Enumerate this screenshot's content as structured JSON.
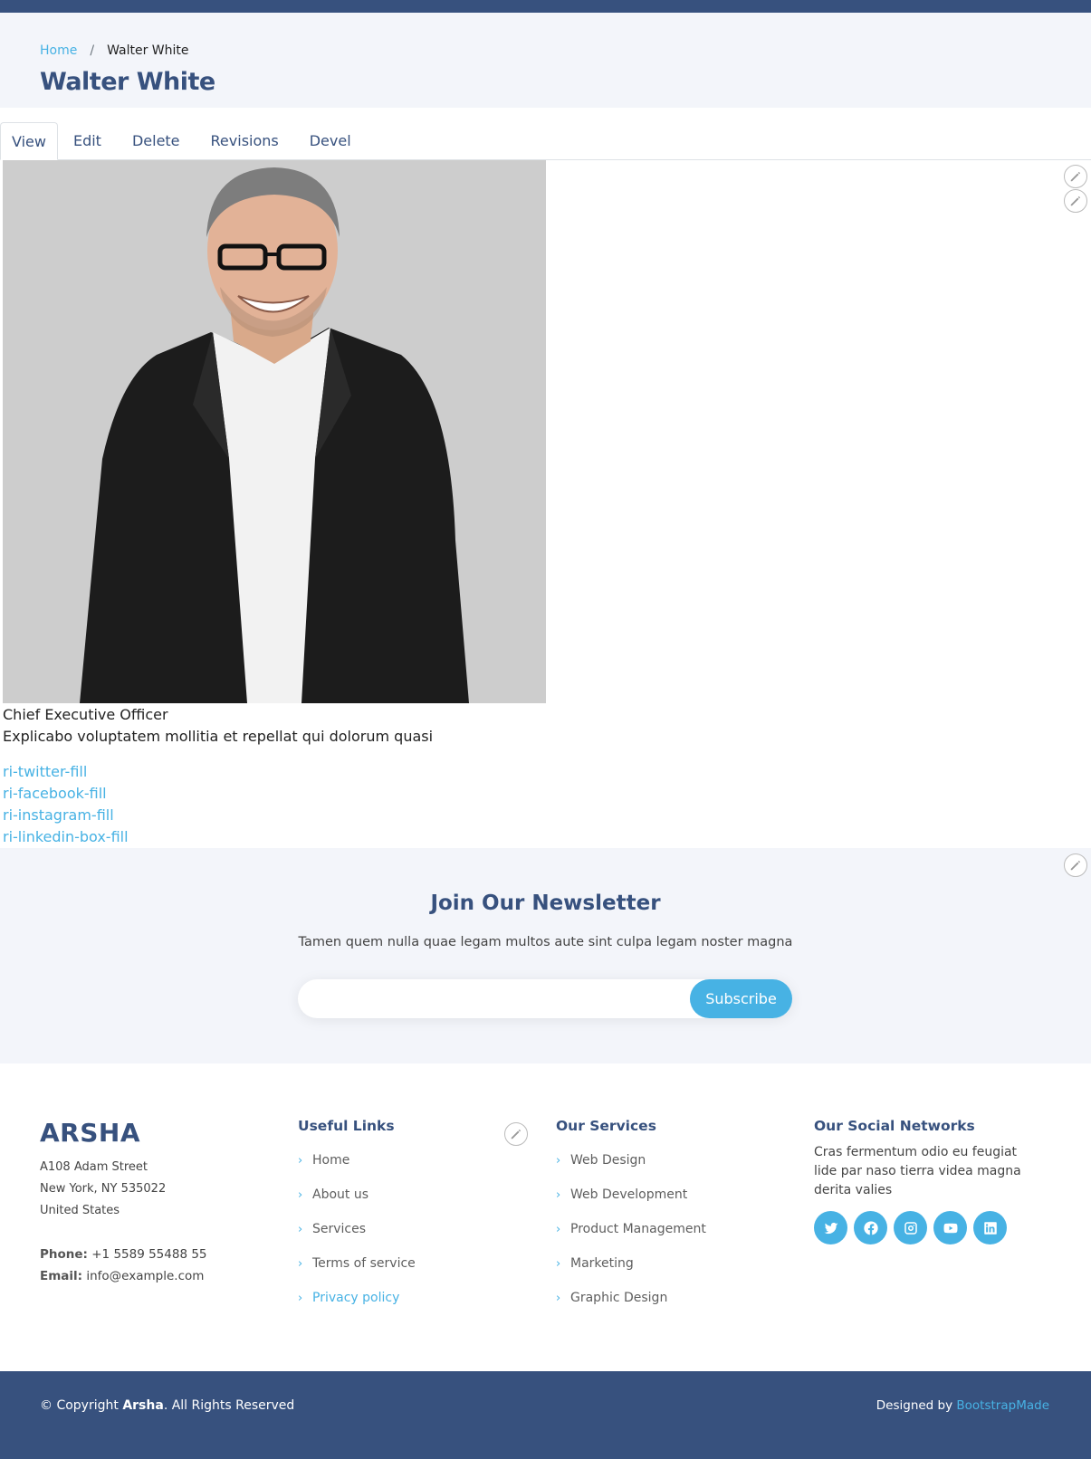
{
  "breadcrumb": {
    "home": "Home",
    "separator": "/",
    "current": "Walter White"
  },
  "page": {
    "title": "Walter White"
  },
  "tabs": [
    {
      "label": "View",
      "active": true
    },
    {
      "label": "Edit"
    },
    {
      "label": "Delete"
    },
    {
      "label": "Revisions"
    },
    {
      "label": "Devel"
    }
  ],
  "member": {
    "role": "Chief Executive Officer",
    "description": "Explicabo voluptatem mollitia et repellat qui dolorum quasi",
    "social": [
      "ri-twitter-fill",
      "ri-facebook-fill",
      "ri-instagram-fill",
      "ri-linkedin-box-fill"
    ]
  },
  "newsletter": {
    "title": "Join Our Newsletter",
    "text": "Tamen quem nulla quae legam multos aute sint culpa legam noster magna",
    "email_value": "",
    "button": "Subscribe"
  },
  "footer": {
    "brand": "ARSHA",
    "address": [
      "A108 Adam Street",
      "New York, NY 535022",
      "United States"
    ],
    "phone_label": "Phone:",
    "phone": "+1 5589 55488 55",
    "email_label": "Email:",
    "email": "info@example.com",
    "useful_links": {
      "title": "Useful Links",
      "items": [
        "Home",
        "About us",
        "Services",
        "Terms of service",
        "Privacy policy"
      ]
    },
    "services": {
      "title": "Our Services",
      "items": [
        "Web Design",
        "Web Development",
        "Product Management",
        "Marketing",
        "Graphic Design"
      ]
    },
    "social": {
      "title": "Our Social Networks",
      "text": "Cras fermentum odio eu feugiat lide par naso tierra videa magna derita valies",
      "icons": [
        "twitter-icon",
        "facebook-icon",
        "instagram-icon",
        "youtube-icon",
        "linkedin-icon"
      ]
    }
  },
  "bottom": {
    "copyright_prefix": "© Copyright",
    "copyright_brand": "Arsha",
    "copyright_suffix": ". All Rights Reserved",
    "designed_by": "Designed by",
    "designer": "BootstrapMade"
  },
  "colors": {
    "primary": "#37517e",
    "accent": "#47b2e4",
    "light_bg": "#f3f5fa"
  }
}
